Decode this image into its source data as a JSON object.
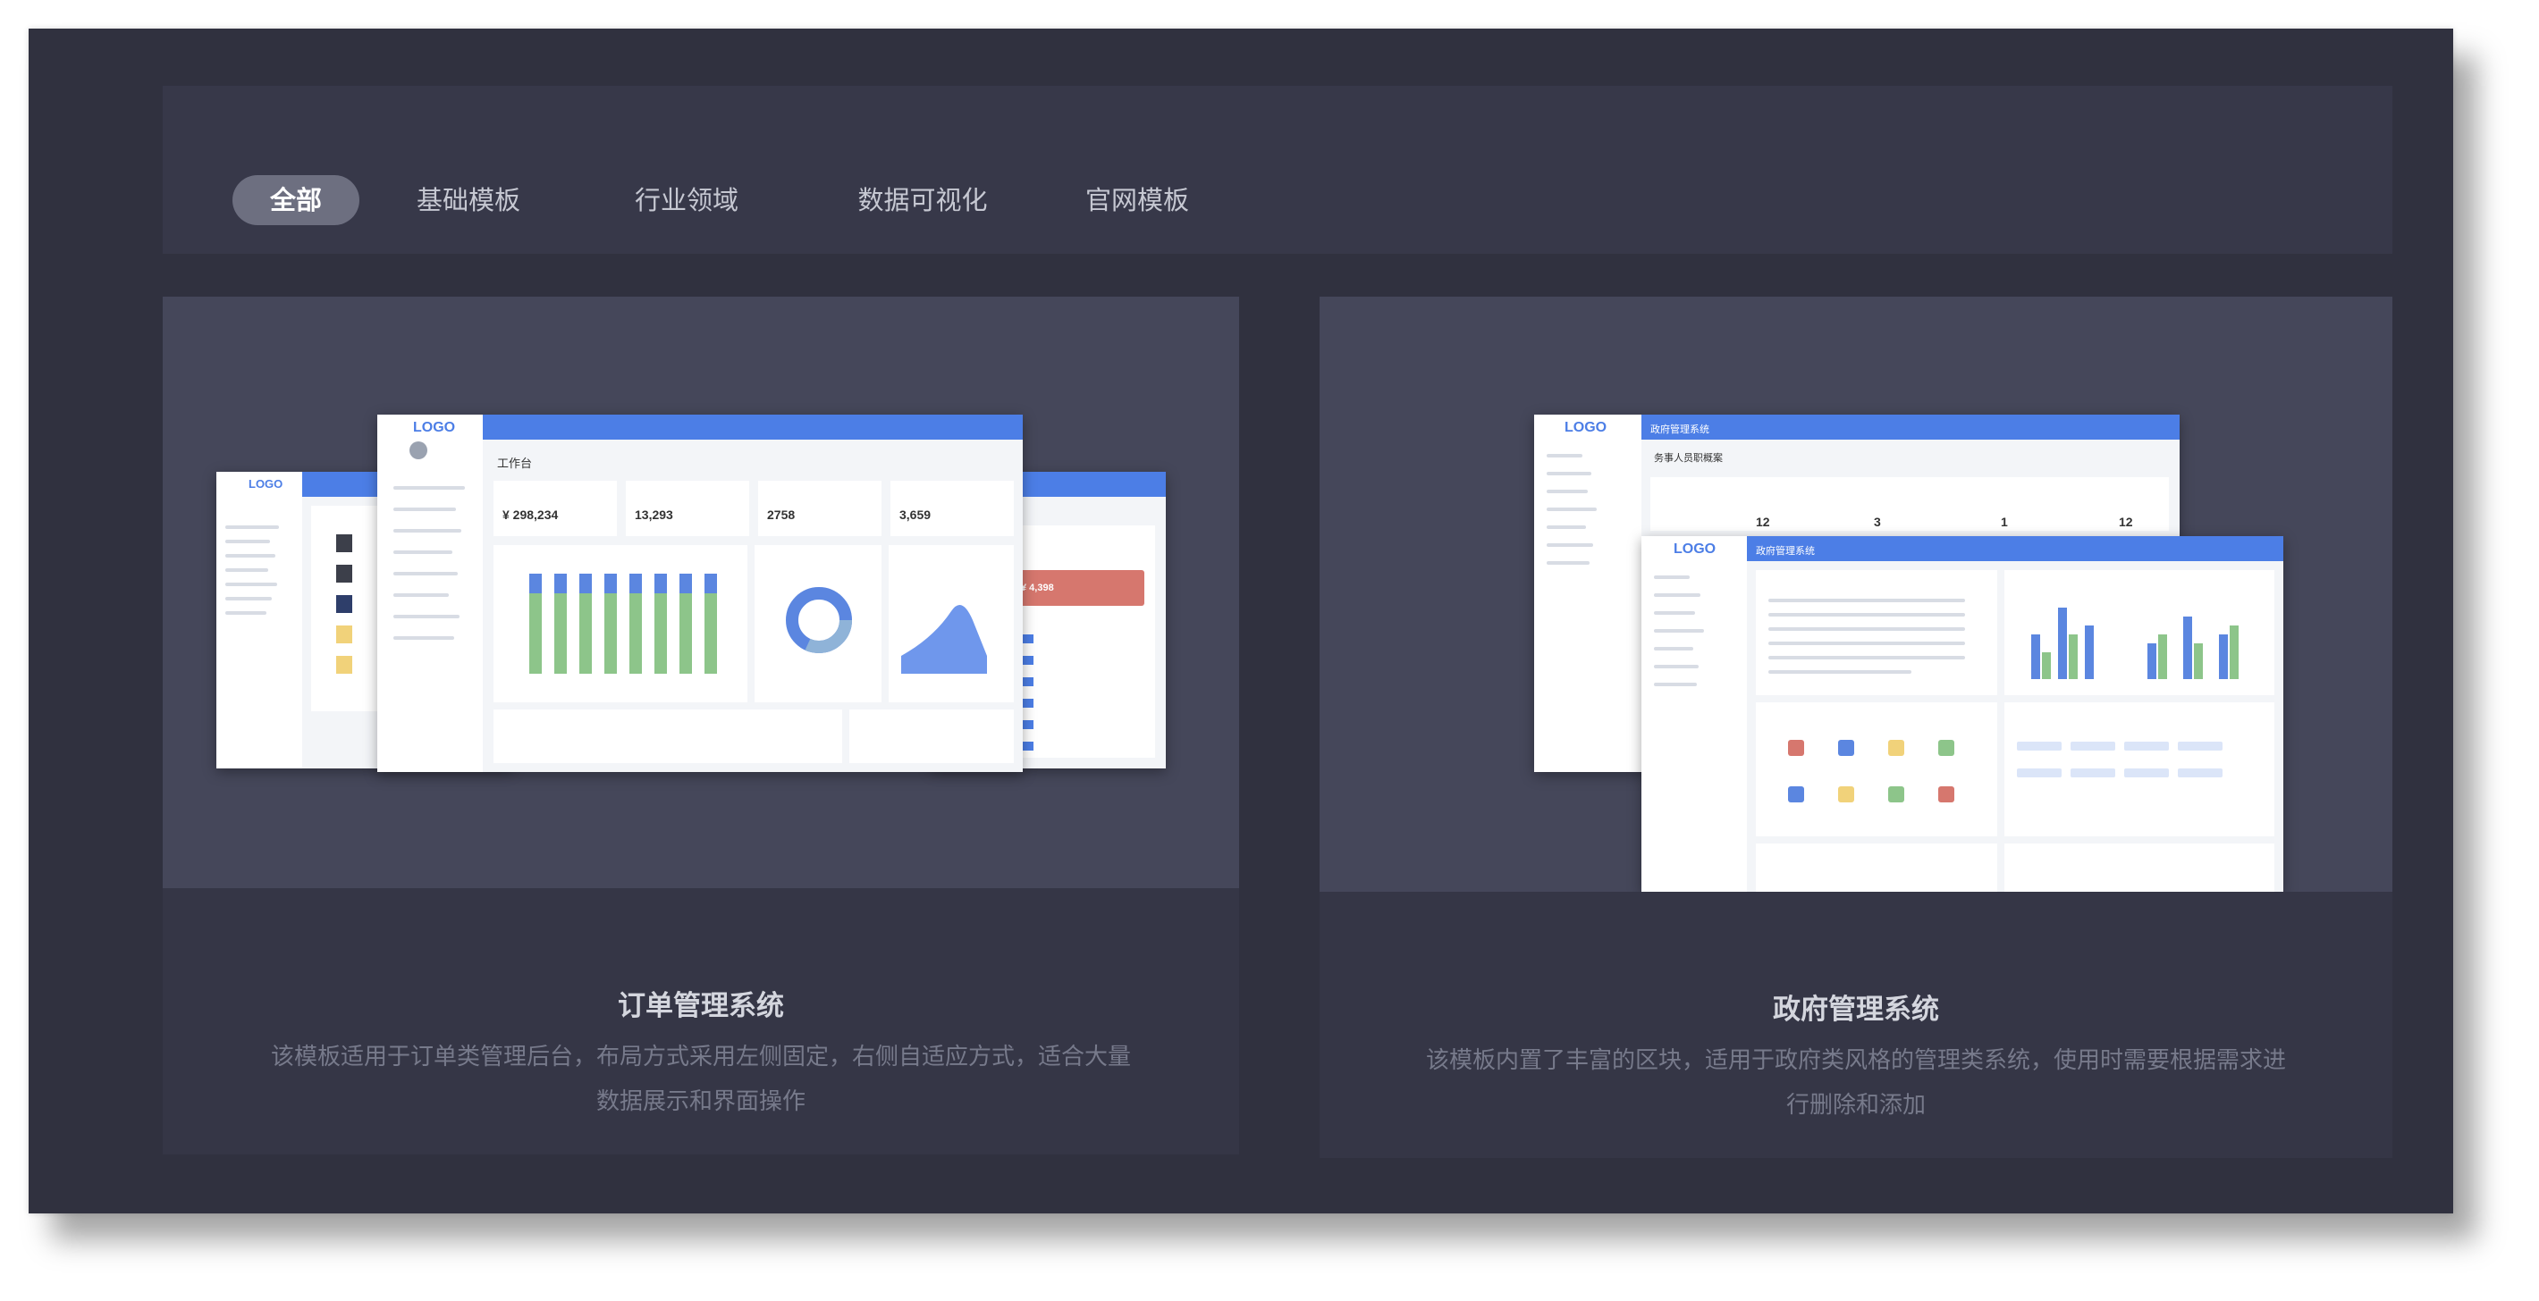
{
  "tabs": [
    {
      "label": "全部",
      "active": true
    },
    {
      "label": "基础模板",
      "active": false
    },
    {
      "label": "行业领域",
      "active": false
    },
    {
      "label": "数据可视化",
      "active": false
    },
    {
      "label": "官网模板",
      "active": false
    }
  ],
  "cards": [
    {
      "title": "订单管理系统",
      "description_line1": "该模板适用于订单类管理后台，布局方式采用左侧固定，右侧自适应方式，适合大量",
      "description_line2": "数据展示和界面操作",
      "preview": {
        "logo": "LOGO",
        "page_title": "工作台",
        "stats": [
          "¥ 298,234",
          "13,293",
          "2758",
          "3,659"
        ],
        "alert_value": "¥ 4,398"
      }
    },
    {
      "title": "政府管理系统",
      "description_line1": "该模板内置了丰富的区块，适用于政府类风格的管理类系统，使用时需要根据需求进",
      "description_line2": "行删除和添加",
      "preview": {
        "logo": "LOGO",
        "back_title": "政府管理系统",
        "front_title": "政府管理系统",
        "back_section": "务事人员职概案",
        "counts": [
          "12",
          "3",
          "1",
          "12"
        ]
      }
    }
  ],
  "colors": {
    "window_bg": "#30313f",
    "tabbar_bg": "#373849",
    "active_tab_bg": "#6d6f80",
    "preview_bg": "#45475a",
    "mock_accent": "#4c7ee6",
    "bar_green": "#8dc58a",
    "bar_blue": "#5b86e0"
  }
}
